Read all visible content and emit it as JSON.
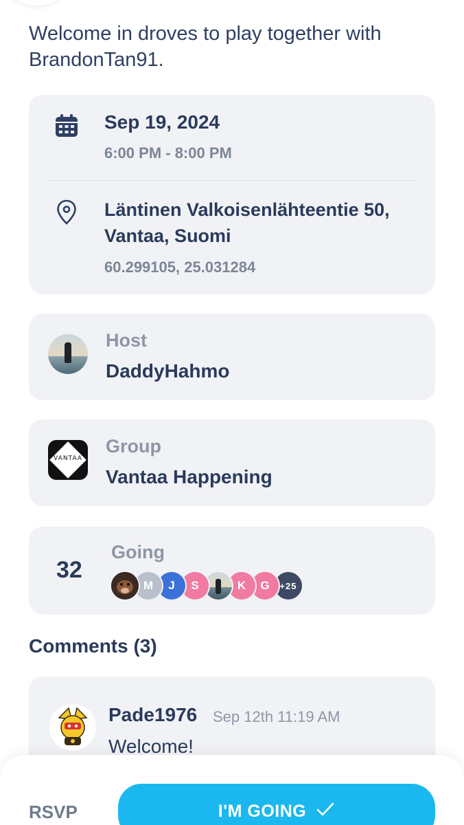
{
  "description": "Welcome in droves to play together with BrandonTan91.",
  "event": {
    "date": "Sep 19, 2024",
    "time": "6:00 PM - 8:00 PM",
    "address": "Läntinen Valkoisenlähteentie 50, Vantaa, Suomi",
    "coords": "60.299105, 25.031284"
  },
  "host": {
    "label": "Host",
    "name": "DaddyHahmo"
  },
  "group": {
    "label": "Group",
    "name": "Vantaa Happening",
    "logo_text": "VANTAA"
  },
  "going": {
    "count": "32",
    "label": "Going",
    "attendees": [
      {
        "initial": "",
        "color": "#5a3b2e",
        "type": "photo-boar"
      },
      {
        "initial": "M",
        "color": "#b9c0cc"
      },
      {
        "initial": "J",
        "color": "#3a72d8"
      },
      {
        "initial": "S",
        "color": "#f07aa0"
      },
      {
        "initial": "",
        "color": "#9fb6bd",
        "type": "photo-person"
      },
      {
        "initial": "K",
        "color": "#f07aa0"
      },
      {
        "initial": "G",
        "color": "#f07aa0"
      },
      {
        "initial": "+25",
        "color": "#3e4a63"
      }
    ]
  },
  "comments": {
    "title": "Comments (3)",
    "items": [
      {
        "author": "Pade1976",
        "date": "Sep 12th 11:19 AM",
        "text": "Welcome!"
      }
    ]
  },
  "footer": {
    "rsvp_label": "RSVP",
    "going_button": "I'M GOING"
  },
  "colors": {
    "accent": "#1ab8ee",
    "card_bg": "#f1f2f5",
    "primary_text": "#2a3a5c",
    "muted_text": "#8e96a6"
  }
}
